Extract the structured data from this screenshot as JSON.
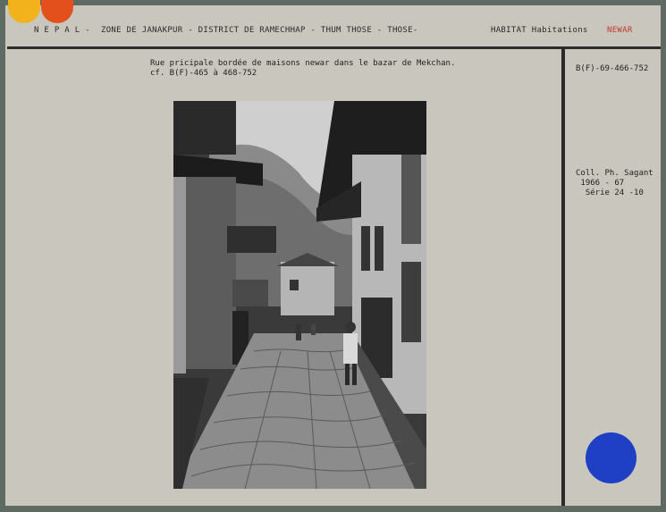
{
  "header": {
    "country": "N E P A L -",
    "zone": "ZONE DE JANAKPUR - DISTRICT DE RAMECHHAP - THUM THOSE - THOSE-",
    "habitat": "HABITAT Habitations",
    "tag": "NEWAR"
  },
  "caption": {
    "line1": "Rue pricipale bordée de maisons newar dans le bazar de Mekchan.",
    "line2": "cf. B(F)-465 à 468-752"
  },
  "side": {
    "ref": "B(F)-69-466-752",
    "coll1": "Coll. Ph. Sagant",
    "coll2": " 1966 - 67",
    "coll3": "  Série 24 -10"
  },
  "colors": {
    "yellow": "#f2b21c",
    "orange": "#e3501c",
    "blue": "#1f3fc4",
    "tag": "#c0392b"
  }
}
